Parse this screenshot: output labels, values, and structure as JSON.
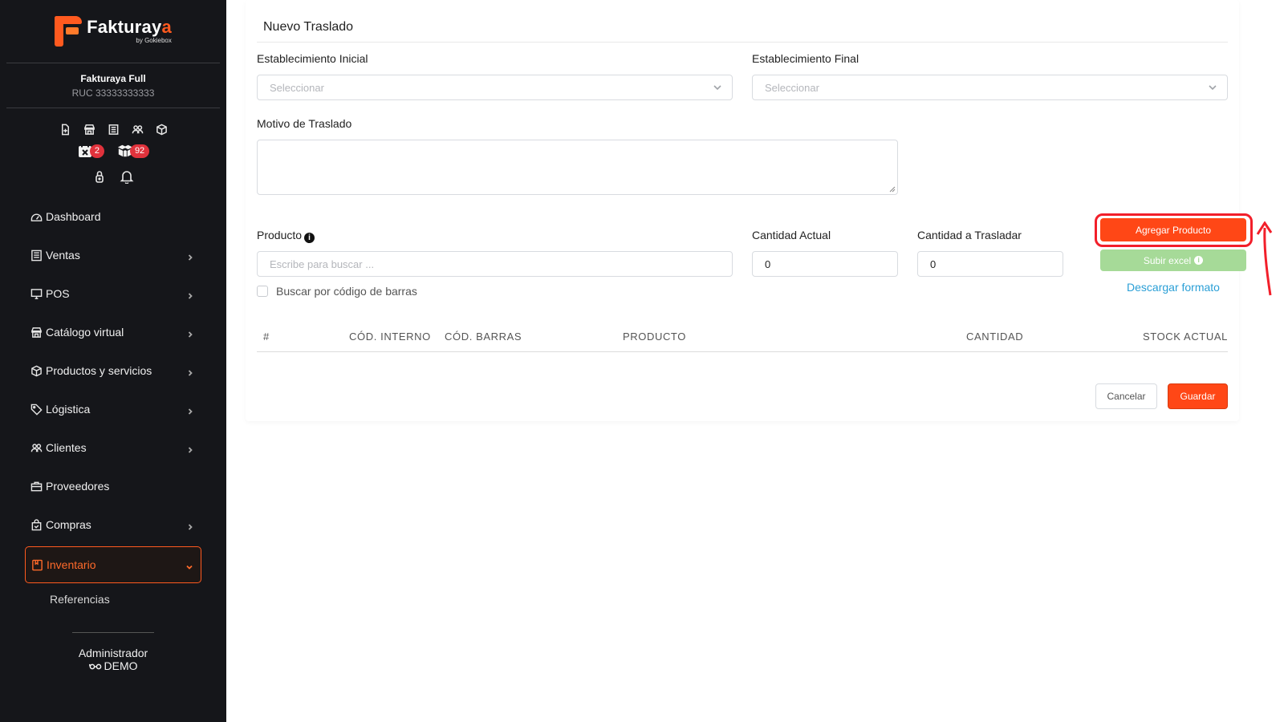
{
  "brand": {
    "name_main": "Fakturay",
    "name_accent": "a",
    "by": "by Gokiebox",
    "accent_color": "#ff5a1f"
  },
  "company": {
    "name": "Fakturaya Full",
    "ruc": "RUC 33333333333"
  },
  "quick_icons": [
    "file-plus-icon",
    "store-icon",
    "receipt-icon",
    "users-icon",
    "box-icon"
  ],
  "badges": {
    "calendar_count": "2",
    "packages_count": "92"
  },
  "sidebar": {
    "items": [
      {
        "label": "Dashboard",
        "icon": "speedometer-icon",
        "has_chevron": false
      },
      {
        "label": "Ventas",
        "icon": "receipt-icon",
        "has_chevron": true
      },
      {
        "label": "POS",
        "icon": "monitor-icon",
        "has_chevron": true
      },
      {
        "label": "Catálogo virtual",
        "icon": "store-icon",
        "has_chevron": true
      },
      {
        "label": "Productos y servicios",
        "icon": "box-icon",
        "has_chevron": true
      },
      {
        "label": "Lógistica",
        "icon": "tag-icon",
        "has_chevron": true
      },
      {
        "label": "Clientes",
        "icon": "users-icon",
        "has_chevron": true
      },
      {
        "label": "Proveedores",
        "icon": "briefcase-icon",
        "has_chevron": false
      },
      {
        "label": "Compras",
        "icon": "bag-icon",
        "has_chevron": true
      },
      {
        "label": "Inventario",
        "icon": "inventory-icon",
        "has_chevron": true,
        "active": true
      }
    ],
    "subitems": [
      "Referencias"
    ]
  },
  "footer": {
    "role": "Administrador",
    "user": "DEMO"
  },
  "form": {
    "title": "Nuevo Traslado",
    "origin_label": "Establecimiento Inicial",
    "origin_value": "Seleccionar",
    "destination_label": "Establecimiento Final",
    "destination_value": "Seleccionar",
    "reason_label": "Motivo de Traslado",
    "product_label": "Producto",
    "product_placeholder": "Escribe para buscar ...",
    "current_qty_label": "Cantidad Actual",
    "current_qty_value": "0",
    "transfer_qty_label": "Cantidad a Trasladar",
    "transfer_qty_value": "0",
    "barcode_search_label": "Buscar por código de barras",
    "add_product_button": "Agregar Producto",
    "upload_excel_button": "Subir excel",
    "download_format_link": "Descargar formato"
  },
  "table": {
    "columns": [
      "#",
      "CÓD. INTERNO",
      "CÓD. BARRAS",
      "PRODUCTO",
      "CANTIDAD",
      "STOCK ACTUAL"
    ],
    "rows": []
  },
  "actions": {
    "cancel": "Cancelar",
    "save": "Guardar"
  },
  "colors": {
    "primary": "#ff4716",
    "success_disabled": "#a6da98",
    "link": "#2a9fd6",
    "highlight": "#f21f2a",
    "sidebar_bg": "#15161a"
  }
}
